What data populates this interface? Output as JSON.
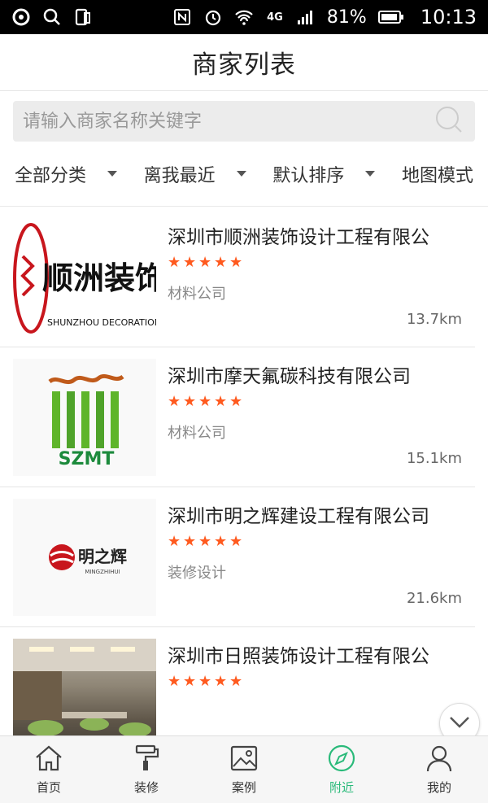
{
  "status_bar": {
    "battery": "81%",
    "time": "10:13",
    "network": "4G"
  },
  "header": {
    "title": "商家列表"
  },
  "search": {
    "placeholder": "请输入商家名称关键字"
  },
  "filters": [
    {
      "label": "全部分类",
      "has_caret": true
    },
    {
      "label": "离我最近",
      "has_caret": true
    },
    {
      "label": "默认排序",
      "has_caret": true
    },
    {
      "label": "地图模式",
      "has_caret": false
    }
  ],
  "merchants": [
    {
      "name": "深圳市顺洲装饰设计工程有限公",
      "rating": 5,
      "category": "材料公司",
      "distance": "13.7km",
      "logo_text": "顺洲装饰",
      "logo_sub": "SHUNZHOU DECORATION"
    },
    {
      "name": "深圳市摩天氟碳科技有限公司",
      "rating": 5,
      "category": "材料公司",
      "distance": "15.1km",
      "logo_text": "SZMT"
    },
    {
      "name": "深圳市明之辉建设工程有限公司",
      "rating": 5,
      "category": "装修设计",
      "distance": "21.6km",
      "logo_text": "明之辉",
      "logo_sub": "MINGZHIHUI"
    },
    {
      "name": "深圳市日照装饰设计工程有限公",
      "rating": 5,
      "category": "",
      "distance": ""
    }
  ],
  "tabs": [
    {
      "label": "首页",
      "icon": "home-icon"
    },
    {
      "label": "装修",
      "icon": "paint-roller-icon"
    },
    {
      "label": "案例",
      "icon": "image-icon"
    },
    {
      "label": "附近",
      "icon": "compass-icon",
      "active": true
    },
    {
      "label": "我的",
      "icon": "user-icon"
    }
  ],
  "colors": {
    "accent": "#2aba7a",
    "star": "#ff5a1f"
  }
}
